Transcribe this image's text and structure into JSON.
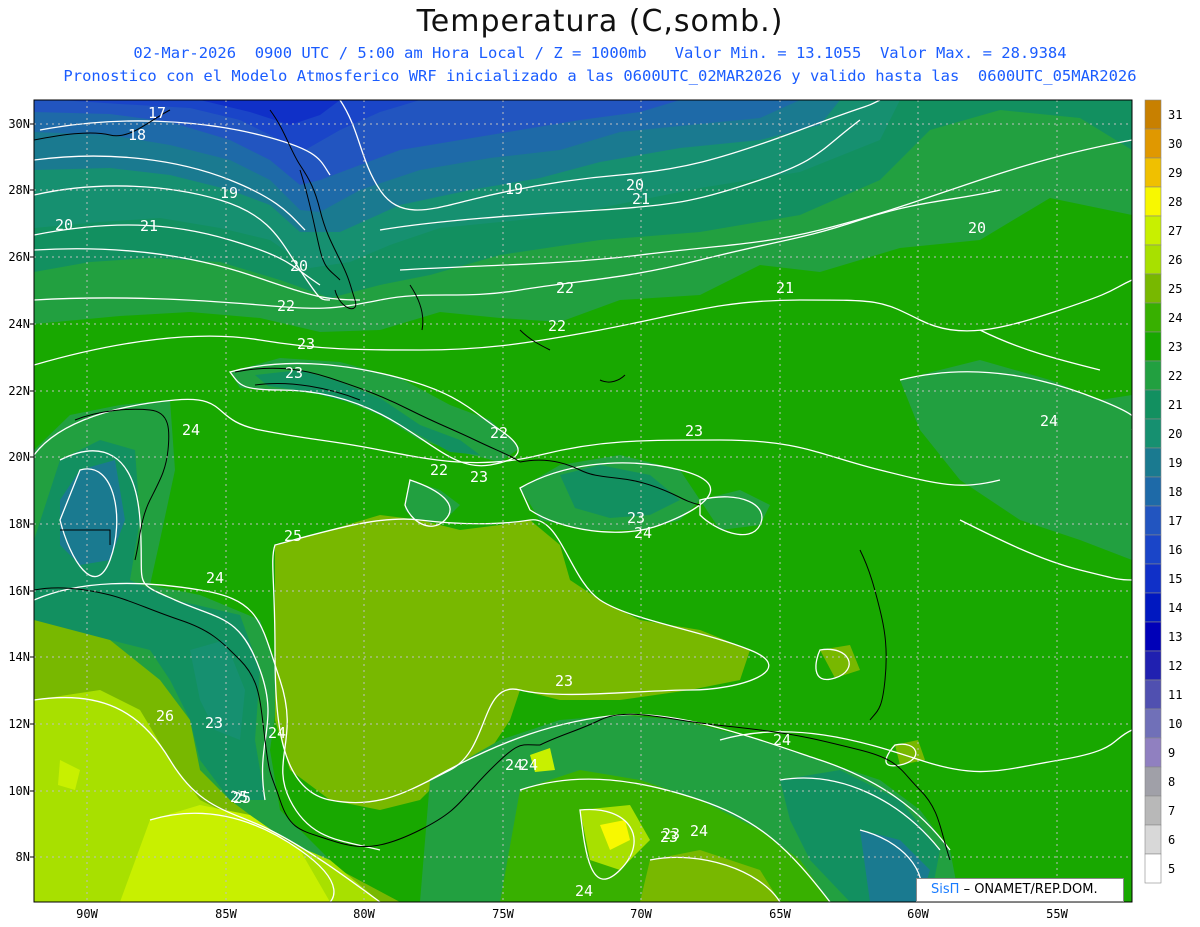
{
  "header": {
    "title": "Temperatura (C,somb.)",
    "line1": "02-Mar-2026  0900 UTC / 5:00 am Hora Local / Z = 1000mb   Valor Min. = 13.1055  Valor Max. = 28.9384",
    "line2": "Pronostico con el Modelo Atmosferico WRF inicializado a las 0600UTC_02MAR2026 y valido hasta las  0600UTC_05MAR2026"
  },
  "axes": {
    "lat_labels": [
      "30N",
      "28N",
      "26N",
      "24N",
      "22N",
      "20N",
      "18N",
      "16N",
      "14N",
      "12N",
      "10N",
      "8N"
    ],
    "lon_labels": [
      "90W",
      "85W",
      "80W",
      "75W",
      "70W",
      "65W",
      "60W",
      "55W"
    ]
  },
  "colorbar": {
    "labels": [
      "31",
      "30",
      "29",
      "28",
      "27",
      "26",
      "25",
      "24",
      "23",
      "22",
      "21",
      "20",
      "19",
      "18",
      "17",
      "16",
      "15",
      "14",
      "13",
      "12",
      "11",
      "10",
      "9",
      "8",
      "7",
      "6",
      "5"
    ],
    "colors": [
      "#c88000",
      "#e09800",
      "#f0c000",
      "#f8f800",
      "#c8f000",
      "#a8e000",
      "#78b800",
      "#38b000",
      "#18a800",
      "#22a040",
      "#129060",
      "#169070",
      "#1a7a90",
      "#1e6aa8",
      "#2255c0",
      "#1a45c8",
      "#1030c8",
      "#0018c0",
      "#0000b8",
      "#2020b0",
      "#5050b0",
      "#7070b8",
      "#9080c0",
      "#a0a0a8",
      "#b8b8b8",
      "#d8d8d8",
      "#ffffff"
    ]
  },
  "contour_labels": [
    "17",
    "18",
    "19",
    "19",
    "20",
    "20",
    "21",
    "21",
    "20",
    "20",
    "21",
    "22",
    "22",
    "22",
    "23",
    "23",
    "22",
    "22",
    "23",
    "23",
    "24",
    "24",
    "23",
    "24",
    "25",
    "24",
    "23",
    "24",
    "24",
    "23",
    "24",
    "26",
    "23",
    "25",
    "25",
    "24",
    "24",
    "23",
    "24"
  ],
  "credit": {
    "brand": "SisΠ",
    "text": "– ONAMET/REP.DOM."
  }
}
